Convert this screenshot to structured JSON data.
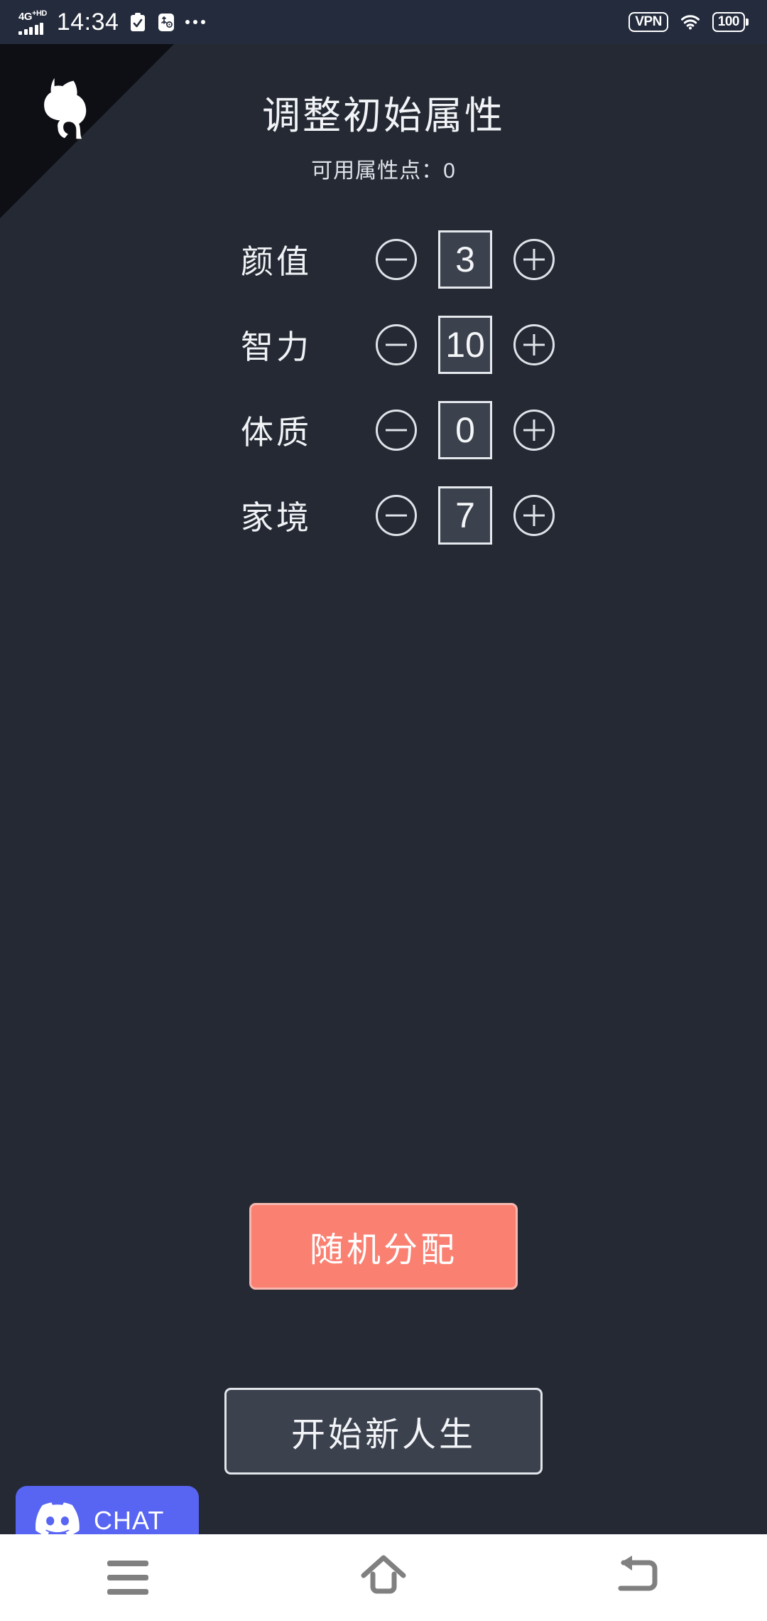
{
  "status_bar": {
    "network_type": "4G",
    "network_sup": "+HD",
    "time": "14:34",
    "clipboard_icon": "clipboard-check-icon",
    "usb_icon": "usb-settings-icon",
    "overflow_icon": "more-dots-icon",
    "vpn_label": "VPN",
    "wifi_icon": "wifi-icon",
    "battery_level": "100"
  },
  "corner": {
    "ribbon_icon": "github-octocat-icon",
    "ribbon_color": "#0d0f14"
  },
  "header": {
    "title": "调整初始属性",
    "subtitle": "可用属性点：0",
    "available_points": "0"
  },
  "attributes": [
    {
      "label": "颜值",
      "value": "3",
      "minus_icon": "minus-circle-icon",
      "plus_icon": "plus-circle-icon"
    },
    {
      "label": "智力",
      "value": "10",
      "minus_icon": "minus-circle-icon",
      "plus_icon": "plus-circle-icon"
    },
    {
      "label": "体质",
      "value": "0",
      "minus_icon": "minus-circle-icon",
      "plus_icon": "plus-circle-icon"
    },
    {
      "label": "家境",
      "value": "7",
      "minus_icon": "minus-circle-icon",
      "plus_icon": "plus-circle-icon"
    }
  ],
  "actions": {
    "random_label": "随机分配",
    "random_color": "#fa8072",
    "start_label": "开始新人生",
    "start_color": "#3b414d"
  },
  "discord_widget": {
    "label": "CHAT",
    "icon": "discord-logo-icon",
    "color": "#5865F2"
  },
  "nav_bar": {
    "recents_icon": "menu-icon",
    "home_icon": "home-arrow-icon",
    "back_icon": "back-arrow-icon"
  },
  "theme": {
    "page_background": "#242933",
    "status_bar_background": "#242B3D",
    "text_color": "#f0f2f5",
    "value_box_fill": "#3b424e"
  }
}
